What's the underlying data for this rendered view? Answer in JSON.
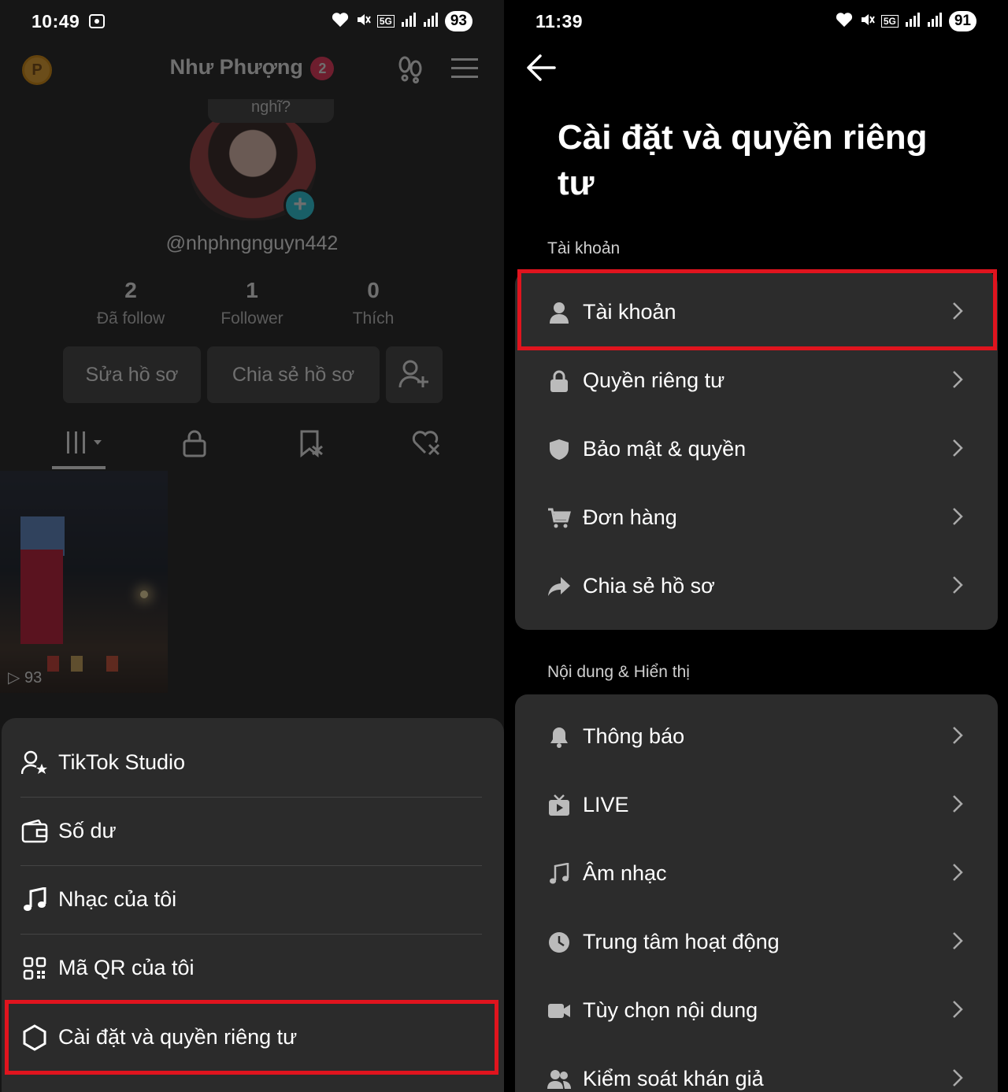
{
  "left": {
    "status": {
      "time": "10:49",
      "battery": "93"
    },
    "profile": {
      "coin_letter": "P",
      "name": "Như Phượng",
      "name_badge": "2",
      "note_text": "nghĩ?",
      "handle": "@nhphngnguyn442",
      "stats": [
        {
          "num": "2",
          "label": "Đã follow"
        },
        {
          "num": "1",
          "label": "Follower"
        },
        {
          "num": "0",
          "label": "Thích"
        }
      ],
      "edit_button": "Sửa hồ sơ",
      "share_button": "Chia sẻ hồ sơ",
      "video_views": "93"
    },
    "sheet": {
      "items": [
        {
          "label": "TikTok Studio",
          "icon": "person-star-icon"
        },
        {
          "label": "Số dư",
          "icon": "wallet-icon"
        },
        {
          "label": "Nhạc của tôi",
          "icon": "music-note-icon"
        },
        {
          "label": "Mã QR của tôi",
          "icon": "qr-code-icon"
        },
        {
          "label": "Cài đặt và quyền riêng tư",
          "icon": "gear-icon"
        }
      ]
    }
  },
  "right": {
    "status": {
      "time": "11:39",
      "battery": "91"
    },
    "title": "Cài đặt và quyền riêng tư",
    "account_section": {
      "label": "Tài khoản",
      "items": [
        {
          "label": "Tài khoản",
          "icon": "person-icon"
        },
        {
          "label": "Quyền riêng tư",
          "icon": "lock-icon"
        },
        {
          "label": "Bảo mật & quyền",
          "icon": "shield-icon"
        },
        {
          "label": "Đơn hàng",
          "icon": "cart-icon"
        },
        {
          "label": "Chia sẻ hồ sơ",
          "icon": "share-arrow-icon"
        }
      ]
    },
    "content_section": {
      "label": "Nội dung & Hiển thị",
      "items": [
        {
          "label": "Thông báo",
          "icon": "bell-icon"
        },
        {
          "label": "LIVE",
          "icon": "live-tv-icon"
        },
        {
          "label": "Âm nhạc",
          "icon": "music-note-icon"
        },
        {
          "label": "Trung tâm hoạt động",
          "icon": "clock-icon"
        },
        {
          "label": "Tùy chọn nội dung",
          "icon": "video-camera-icon"
        },
        {
          "label": "Kiểm soát khán giả",
          "icon": "people-icon"
        }
      ]
    }
  },
  "colors": {
    "highlight": "#e0141e",
    "accent_pink": "#fe2c55",
    "accent_cyan": "#20d5ec"
  }
}
